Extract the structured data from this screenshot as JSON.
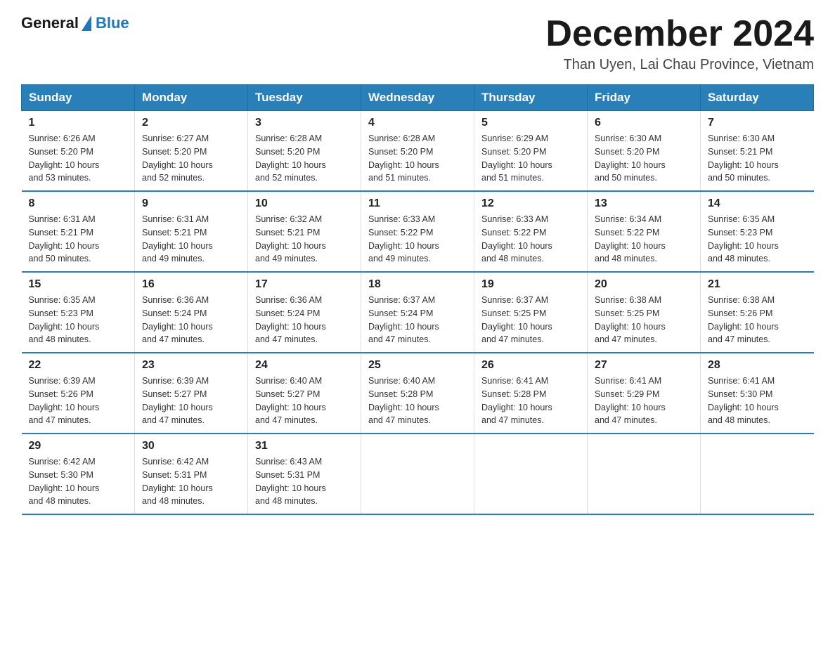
{
  "header": {
    "logo": {
      "general": "General",
      "blue": "Blue",
      "tagline": ""
    },
    "title": "December 2024",
    "subtitle": "Than Uyen, Lai Chau Province, Vietnam"
  },
  "weekdays": [
    "Sunday",
    "Monday",
    "Tuesday",
    "Wednesday",
    "Thursday",
    "Friday",
    "Saturday"
  ],
  "weeks": [
    [
      {
        "day": "1",
        "sunrise": "6:26 AM",
        "sunset": "5:20 PM",
        "daylight": "10 hours and 53 minutes."
      },
      {
        "day": "2",
        "sunrise": "6:27 AM",
        "sunset": "5:20 PM",
        "daylight": "10 hours and 52 minutes."
      },
      {
        "day": "3",
        "sunrise": "6:28 AM",
        "sunset": "5:20 PM",
        "daylight": "10 hours and 52 minutes."
      },
      {
        "day": "4",
        "sunrise": "6:28 AM",
        "sunset": "5:20 PM",
        "daylight": "10 hours and 51 minutes."
      },
      {
        "day": "5",
        "sunrise": "6:29 AM",
        "sunset": "5:20 PM",
        "daylight": "10 hours and 51 minutes."
      },
      {
        "day": "6",
        "sunrise": "6:30 AM",
        "sunset": "5:20 PM",
        "daylight": "10 hours and 50 minutes."
      },
      {
        "day": "7",
        "sunrise": "6:30 AM",
        "sunset": "5:21 PM",
        "daylight": "10 hours and 50 minutes."
      }
    ],
    [
      {
        "day": "8",
        "sunrise": "6:31 AM",
        "sunset": "5:21 PM",
        "daylight": "10 hours and 50 minutes."
      },
      {
        "day": "9",
        "sunrise": "6:31 AM",
        "sunset": "5:21 PM",
        "daylight": "10 hours and 49 minutes."
      },
      {
        "day": "10",
        "sunrise": "6:32 AM",
        "sunset": "5:21 PM",
        "daylight": "10 hours and 49 minutes."
      },
      {
        "day": "11",
        "sunrise": "6:33 AM",
        "sunset": "5:22 PM",
        "daylight": "10 hours and 49 minutes."
      },
      {
        "day": "12",
        "sunrise": "6:33 AM",
        "sunset": "5:22 PM",
        "daylight": "10 hours and 48 minutes."
      },
      {
        "day": "13",
        "sunrise": "6:34 AM",
        "sunset": "5:22 PM",
        "daylight": "10 hours and 48 minutes."
      },
      {
        "day": "14",
        "sunrise": "6:35 AM",
        "sunset": "5:23 PM",
        "daylight": "10 hours and 48 minutes."
      }
    ],
    [
      {
        "day": "15",
        "sunrise": "6:35 AM",
        "sunset": "5:23 PM",
        "daylight": "10 hours and 48 minutes."
      },
      {
        "day": "16",
        "sunrise": "6:36 AM",
        "sunset": "5:24 PM",
        "daylight": "10 hours and 47 minutes."
      },
      {
        "day": "17",
        "sunrise": "6:36 AM",
        "sunset": "5:24 PM",
        "daylight": "10 hours and 47 minutes."
      },
      {
        "day": "18",
        "sunrise": "6:37 AM",
        "sunset": "5:24 PM",
        "daylight": "10 hours and 47 minutes."
      },
      {
        "day": "19",
        "sunrise": "6:37 AM",
        "sunset": "5:25 PM",
        "daylight": "10 hours and 47 minutes."
      },
      {
        "day": "20",
        "sunrise": "6:38 AM",
        "sunset": "5:25 PM",
        "daylight": "10 hours and 47 minutes."
      },
      {
        "day": "21",
        "sunrise": "6:38 AM",
        "sunset": "5:26 PM",
        "daylight": "10 hours and 47 minutes."
      }
    ],
    [
      {
        "day": "22",
        "sunrise": "6:39 AM",
        "sunset": "5:26 PM",
        "daylight": "10 hours and 47 minutes."
      },
      {
        "day": "23",
        "sunrise": "6:39 AM",
        "sunset": "5:27 PM",
        "daylight": "10 hours and 47 minutes."
      },
      {
        "day": "24",
        "sunrise": "6:40 AM",
        "sunset": "5:27 PM",
        "daylight": "10 hours and 47 minutes."
      },
      {
        "day": "25",
        "sunrise": "6:40 AM",
        "sunset": "5:28 PM",
        "daylight": "10 hours and 47 minutes."
      },
      {
        "day": "26",
        "sunrise": "6:41 AM",
        "sunset": "5:28 PM",
        "daylight": "10 hours and 47 minutes."
      },
      {
        "day": "27",
        "sunrise": "6:41 AM",
        "sunset": "5:29 PM",
        "daylight": "10 hours and 47 minutes."
      },
      {
        "day": "28",
        "sunrise": "6:41 AM",
        "sunset": "5:30 PM",
        "daylight": "10 hours and 48 minutes."
      }
    ],
    [
      {
        "day": "29",
        "sunrise": "6:42 AM",
        "sunset": "5:30 PM",
        "daylight": "10 hours and 48 minutes."
      },
      {
        "day": "30",
        "sunrise": "6:42 AM",
        "sunset": "5:31 PM",
        "daylight": "10 hours and 48 minutes."
      },
      {
        "day": "31",
        "sunrise": "6:43 AM",
        "sunset": "5:31 PM",
        "daylight": "10 hours and 48 minutes."
      },
      null,
      null,
      null,
      null
    ]
  ],
  "labels": {
    "sunrise": "Sunrise:",
    "sunset": "Sunset:",
    "daylight": "Daylight:"
  }
}
